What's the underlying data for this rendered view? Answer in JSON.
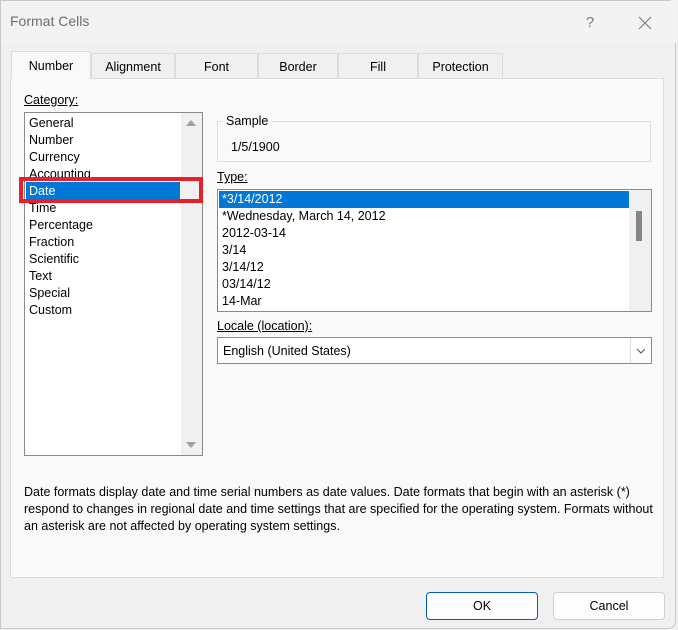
{
  "window": {
    "title": "Format Cells",
    "help_label": "?",
    "close_icon": "close-icon"
  },
  "tabs": [
    {
      "label": "Number",
      "active": true
    },
    {
      "label": "Alignment",
      "active": false
    },
    {
      "label": "Font",
      "active": false
    },
    {
      "label": "Border",
      "active": false
    },
    {
      "label": "Fill",
      "active": false
    },
    {
      "label": "Protection",
      "active": false
    }
  ],
  "category": {
    "label": "Category:",
    "items": [
      "General",
      "Number",
      "Currency",
      "Accounting",
      "Date",
      "Time",
      "Percentage",
      "Fraction",
      "Scientific",
      "Text",
      "Special",
      "Custom"
    ],
    "selected": "Date"
  },
  "sample": {
    "label": "Sample",
    "value": "1/5/1900"
  },
  "type": {
    "label": "Type:",
    "items": [
      "*3/14/2012",
      "*Wednesday, March 14, 2012",
      "2012-03-14",
      "3/14",
      "3/14/12",
      "03/14/12",
      "14-Mar"
    ],
    "selected": "*3/14/2012"
  },
  "locale": {
    "label": "Locale (location):",
    "value": "English (United States)"
  },
  "description": "Date formats display date and time serial numbers as date values.  Date formats that begin with an asterisk (*) respond to changes in regional date and time settings that are specified for the operating system. Formats without an asterisk are not affected by operating system settings.",
  "buttons": {
    "ok": "OK",
    "cancel": "Cancel"
  },
  "colors": {
    "selection": "#0078d7",
    "highlight_box": "#e8202a",
    "ok_border": "#005fb8"
  }
}
